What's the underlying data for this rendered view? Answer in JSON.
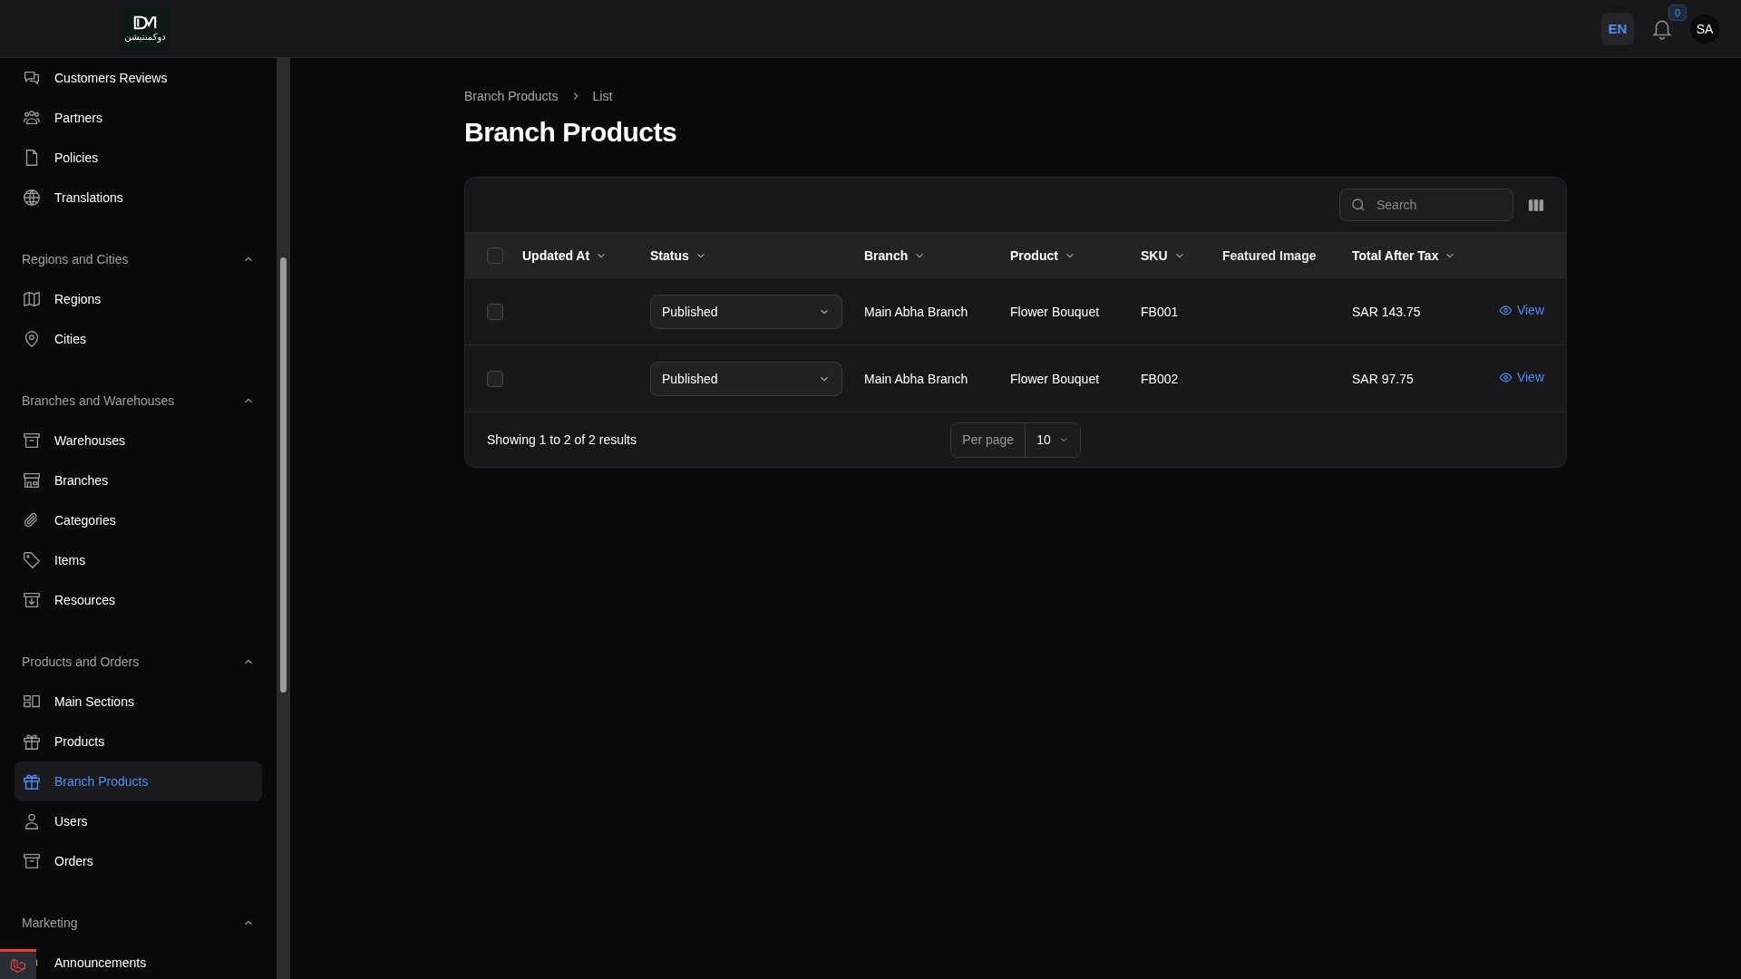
{
  "header": {
    "logo_text": "دوكمنتيشن",
    "language": "EN",
    "notifications_count": "0",
    "user_initials": "SA"
  },
  "sidebar": {
    "sections": [
      {
        "items": [
          {
            "label": "Customers Reviews",
            "selected": false
          },
          {
            "label": "Partners",
            "selected": false
          },
          {
            "label": "Policies",
            "selected": false
          },
          {
            "label": "Translations",
            "selected": false
          }
        ]
      },
      {
        "label": "Regions and Cities",
        "expanded": true,
        "items": [
          {
            "label": "Regions",
            "selected": false
          },
          {
            "label": "Cities",
            "selected": false
          }
        ]
      },
      {
        "label": "Branches and Warehouses",
        "expanded": true,
        "items": [
          {
            "label": "Warehouses",
            "selected": false
          },
          {
            "label": "Branches",
            "selected": false
          },
          {
            "label": "Categories",
            "selected": false
          },
          {
            "label": "Items",
            "selected": false
          },
          {
            "label": "Resources",
            "selected": false
          }
        ]
      },
      {
        "label": "Products and Orders",
        "expanded": true,
        "items": [
          {
            "label": "Main Sections",
            "selected": false
          },
          {
            "label": "Products",
            "selected": false
          },
          {
            "label": "Branch Products",
            "selected": true
          },
          {
            "label": "Users",
            "selected": false
          },
          {
            "label": "Orders",
            "selected": false
          }
        ]
      },
      {
        "label": "Marketing",
        "expanded": true,
        "items": [
          {
            "label": "Announcements",
            "selected": false
          }
        ]
      }
    ]
  },
  "breadcrumb": [
    "Branch Products",
    "List"
  ],
  "page_title": "Branch Products",
  "table": {
    "search": {
      "placeholder": "Search"
    },
    "select_all": {
      "checked": false
    },
    "columns": [
      {
        "label": "Updated At",
        "sortable": true
      },
      {
        "label": "Status",
        "sortable": true
      },
      {
        "label": "Branch",
        "sortable": true
      },
      {
        "label": "Product",
        "sortable": true
      },
      {
        "label": "SKU",
        "sortable": true
      },
      {
        "label": "Featured Image",
        "sortable": false
      },
      {
        "label": "Total After Tax",
        "sortable": true
      }
    ],
    "rows": [
      {
        "checked": false,
        "status": "Published",
        "branch": "Main Abha Branch",
        "product": "Flower Bouquet",
        "sku": "FB001",
        "total": "SAR 143.75",
        "action": "View"
      },
      {
        "checked": false,
        "status": "Published",
        "branch": "Main Abha Branch",
        "product": "Flower Bouquet",
        "sku": "FB002",
        "total": "SAR 97.75",
        "action": "View"
      }
    ],
    "summary": "Showing 1 to 2 of 2 results",
    "per_page": {
      "label": "Per page",
      "value": "10"
    }
  }
}
